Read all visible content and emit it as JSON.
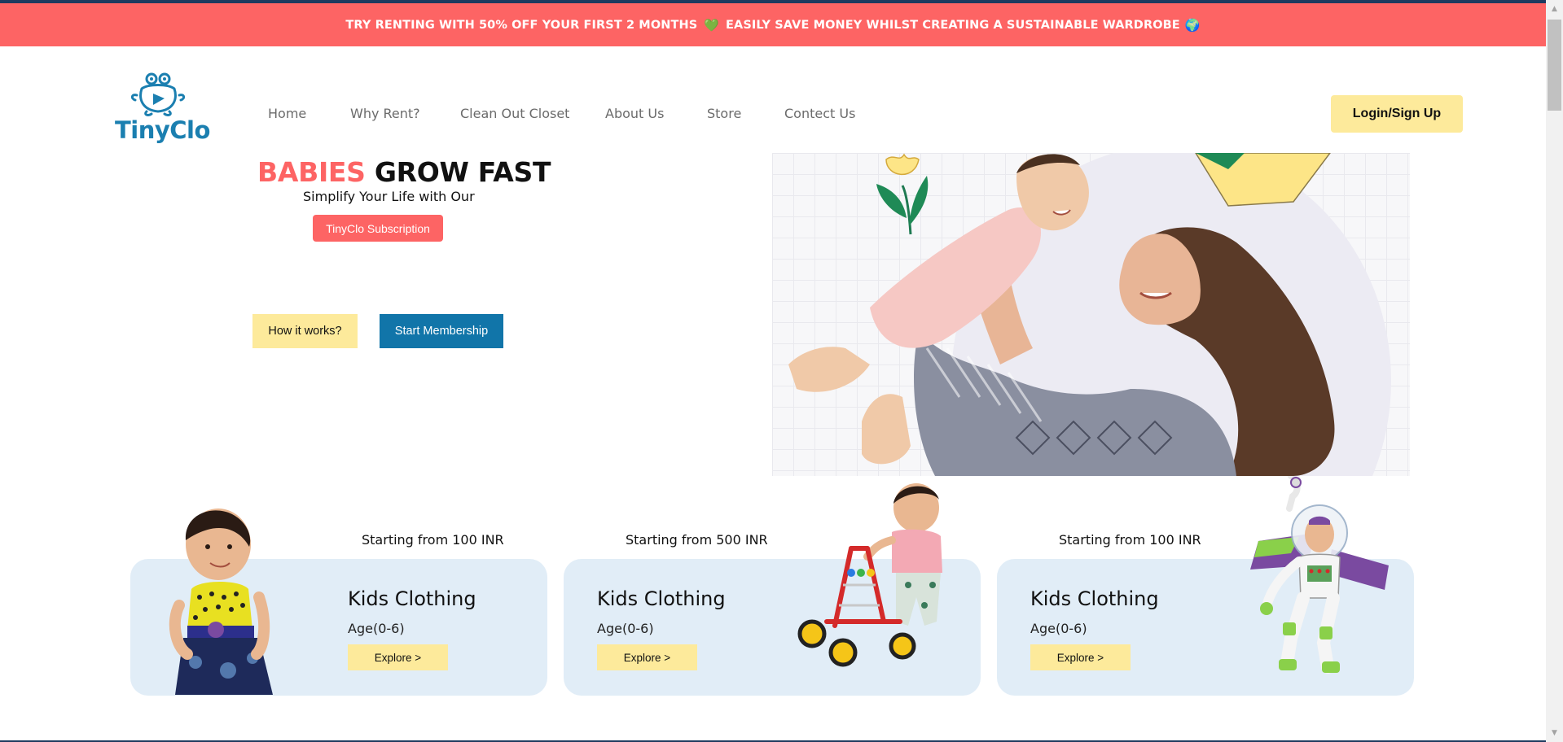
{
  "promo": {
    "text_part1": "TRY RENTING WITH 50% OFF YOUR FIRST 2 MONTHS",
    "heart_icon": "💚",
    "text_part2": "EASILY SAVE MONEY WHILST CREATING A SUSTAINABLE WARDROBE",
    "globe_icon": "🌍"
  },
  "brand": {
    "name": "TinyClo",
    "color": "#1b7fb0"
  },
  "nav": {
    "items": [
      {
        "label": "Home"
      },
      {
        "label": "Why Rent?"
      },
      {
        "label": "Clean Out Closet"
      },
      {
        "label": "About Us"
      },
      {
        "label": "Store"
      },
      {
        "label": "Contect Us"
      }
    ],
    "login_label": "Login/Sign Up"
  },
  "hero": {
    "title_accent": "BABIES",
    "title_rest": "GROW FAST",
    "subtitle": "Simplify Your Life with Our",
    "subscription_label": "TinyClo Subscription",
    "how_label": "How it works?",
    "start_label": "Start Membership"
  },
  "cards": [
    {
      "price": "Starting from 100 INR",
      "title": "Kids Clothing",
      "age": "Age(0-6)",
      "button": "Explore >"
    },
    {
      "price": "Starting from 500 INR",
      "title": "Kids Clothing",
      "age": "Age(0-6)",
      "button": "Explore >"
    },
    {
      "price": "Starting from 100 INR",
      "title": "Kids Clothing",
      "age": "Age(0-6)",
      "button": "Explore >"
    }
  ],
  "colors": {
    "accent": "#fd6464",
    "primary": "#1175a9",
    "yellow": "#fdea9b",
    "card_bg": "#e1edf7"
  }
}
